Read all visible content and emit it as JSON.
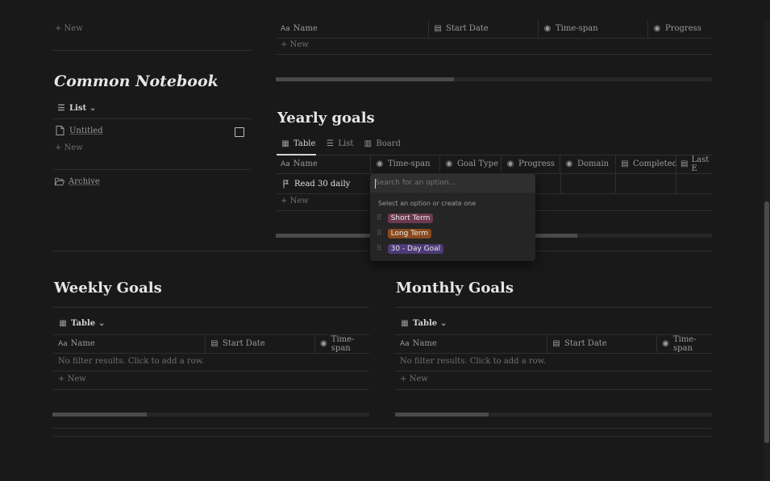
{
  "sidebar": {
    "top_new": "+ New",
    "notebook_title": "Common Notebook",
    "list_view_label": "List",
    "untitled": "Untitled",
    "new_label": "+ New",
    "archive": "Archive"
  },
  "top_table": {
    "columns": [
      "Name",
      "Start Date",
      "Time-span",
      "Progress"
    ],
    "new_label": "New"
  },
  "yearly": {
    "title": "Yearly goals",
    "tabs": [
      "Table",
      "List",
      "Board"
    ],
    "columns": [
      "Name",
      "Time-span",
      "Goal Type",
      "Progress",
      "Domain",
      "Completed",
      "Last E"
    ],
    "row_name": "Read 30 daily",
    "new_label": "New"
  },
  "dropdown": {
    "placeholder": "Search for an option...",
    "hint": "Select an option or create one",
    "options": [
      {
        "label": "Short Term",
        "color": "#6b3a4e"
      },
      {
        "label": "Long Term",
        "color": "#8a4a1e"
      },
      {
        "label": "30 - Day Goal",
        "color": "#4d3a78"
      }
    ]
  },
  "weekly": {
    "title": "Weekly Goals",
    "view": "Table",
    "columns": [
      "Name",
      "Start Date",
      "Time-span"
    ],
    "empty": "No filter results. Click to add a row.",
    "new_label": "New"
  },
  "monthly": {
    "title": "Monthly Goals",
    "view": "Table",
    "columns": [
      "Name",
      "Start Date",
      "Time-span"
    ],
    "empty": "No filter results. Click to add a row.",
    "new_label": "New"
  }
}
